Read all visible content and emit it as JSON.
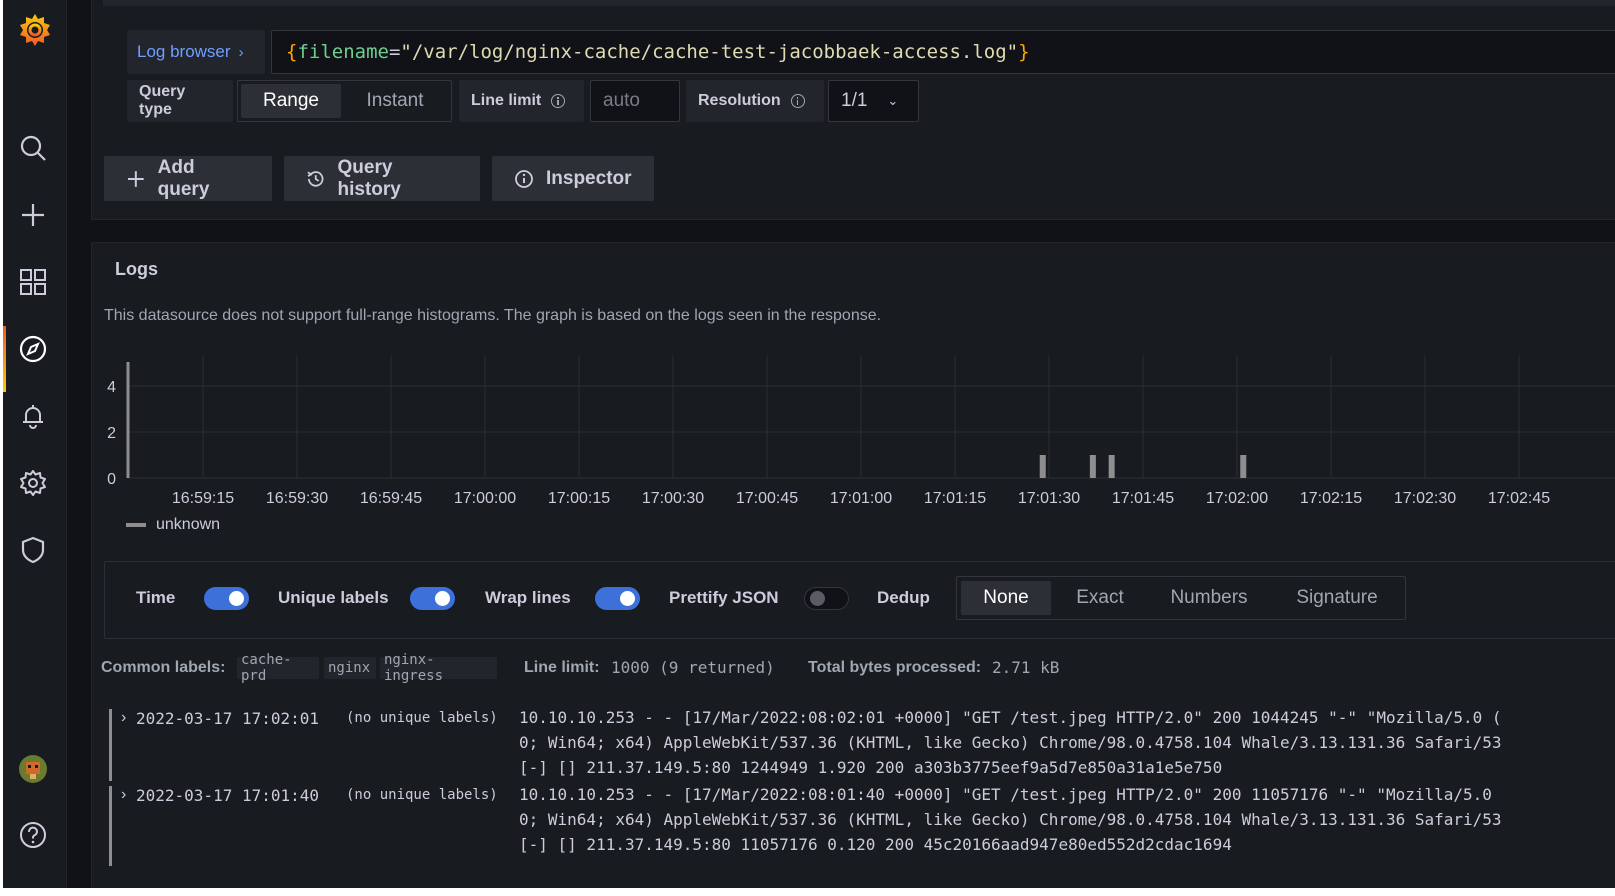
{
  "query": {
    "log_browser_label": "Log browser",
    "brace_open": "{",
    "key": "filename",
    "eq": "=",
    "value": "\"/var/log/nginx-cache/cache-test-jacobbaek-access.log\"",
    "brace_close": "}"
  },
  "options": {
    "query_type_label": "Query type",
    "range_label": "Range",
    "instant_label": "Instant",
    "selected_query_type": "Range",
    "line_limit_label": "Line limit",
    "line_limit_placeholder": "auto",
    "resolution_label": "Resolution",
    "resolution_value": "1/1"
  },
  "actions": {
    "add_query": "Add query",
    "query_history": "Query history",
    "inspector": "Inspector"
  },
  "logs": {
    "title": "Logs",
    "note": "This datasource does not support full-range histograms. The graph is based on the logs seen in the response."
  },
  "chart_data": {
    "type": "bar",
    "x_ticks": [
      "16:59:15",
      "16:59:30",
      "16:59:45",
      "17:00:00",
      "17:00:15",
      "17:00:30",
      "17:00:45",
      "17:01:00",
      "17:01:15",
      "17:01:30",
      "17:01:45",
      "17:02:00",
      "17:02:15",
      "17:02:30",
      "17:02:45"
    ],
    "y_ticks": [
      "0",
      "2",
      "4"
    ],
    "ylim": [
      0,
      5
    ],
    "grid": true,
    "legend_position": "bottom-left",
    "series": [
      {
        "name": "unknown",
        "color": "#8e8e8e",
        "points": [
          {
            "x": "17:01:29",
            "y": 1
          },
          {
            "x": "17:01:37",
            "y": 1
          },
          {
            "x": "17:01:40",
            "y": 1
          },
          {
            "x": "17:02:01",
            "y": 1
          }
        ]
      }
    ]
  },
  "log_options": {
    "time_label": "Time",
    "time_on": true,
    "unique_labels_label": "Unique labels",
    "unique_labels_on": true,
    "wrap_lines_label": "Wrap lines",
    "wrap_lines_on": true,
    "prettify_json_label": "Prettify JSON",
    "prettify_json_on": false,
    "dedup_label": "Dedup",
    "dedup_options": [
      "None",
      "Exact",
      "Numbers",
      "Signature"
    ],
    "dedup_selected": "None"
  },
  "meta": {
    "common_labels_label": "Common labels:",
    "common_labels": [
      "cache-prd",
      "nginx",
      "nginx-ingress"
    ],
    "line_limit_label": "Line limit:",
    "line_limit_value": "1000 (9 returned)",
    "bytes_label": "Total bytes processed:",
    "bytes_value": "2.71 kB"
  },
  "rows": [
    {
      "timestamp": "2022-03-17 17:02:01",
      "labels": "(no unique labels)",
      "lines": [
        "10.10.10.253 - - [17/Mar/2022:08:02:01 +0000] \"GET /test.jpeg HTTP/2.0\" 200 1044245 \"-\" \"Mozilla/5.0 (",
        "0; Win64; x64) AppleWebKit/537.36 (KHTML, like Gecko) Chrome/98.0.4758.104 Whale/3.13.131.36 Safari/53",
        "[-] [] 211.37.149.5:80 1244949 1.920 200 a303b3775eef9a5d7e850a31a1e5e750"
      ]
    },
    {
      "timestamp": "2022-03-17 17:01:40",
      "labels": "(no unique labels)",
      "lines": [
        "10.10.10.253 - - [17/Mar/2022:08:01:40 +0000] \"GET /test.jpeg HTTP/2.0\" 200 11057176 \"-\" \"Mozilla/5.0",
        "0; Win64; x64) AppleWebKit/537.36 (KHTML, like Gecko) Chrome/98.0.4758.104 Whale/3.13.131.36 Safari/53",
        "[-] [] 211.37.149.5:80 11057176 0.120 200 45c20166aad947e80ed552d2cdac1694"
      ]
    }
  ]
}
